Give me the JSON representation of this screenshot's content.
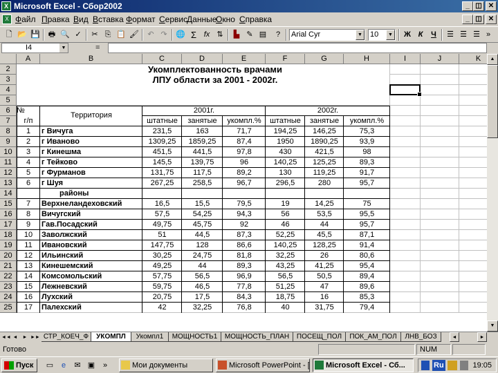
{
  "window": {
    "title": "Microsoft Excel - Сбор2002",
    "controls": [
      "_",
      "◫",
      "✕"
    ],
    "doc_controls": [
      "_",
      "◫",
      "✕"
    ]
  },
  "menu": {
    "items": [
      "Файл",
      "Правка",
      "Вид",
      "Вставка",
      "Формат",
      "Сервис",
      "Данные",
      "Окно",
      "Справка"
    ]
  },
  "toolbar": {
    "font_name": "Arial Cyr",
    "font_size": "10",
    "bold": "Ж",
    "italic": "К",
    "underline": "Ч",
    "sigma": "Σ",
    "fx": "fx"
  },
  "formula_bar": {
    "cell_ref": "I4",
    "equals": "=",
    "value": ""
  },
  "columns": [
    "A",
    "B",
    "C",
    "D",
    "E",
    "F",
    "G",
    "H",
    "I",
    "J",
    "K"
  ],
  "rows": [
    "2",
    "3",
    "4",
    "5",
    "6",
    "7",
    "8",
    "9",
    "10",
    "11",
    "12",
    "13",
    "14",
    "15",
    "16",
    "17",
    "18",
    "19",
    "20",
    "21",
    "22",
    "23",
    "24",
    "25"
  ],
  "sheet": {
    "title_line1": "Укомплектованность врачами",
    "title_line2": "ЛПУ области за  2001 - 2002г.",
    "hdr_no": "№",
    "hdr_gp": "г/п",
    "hdr_territory": "Территория",
    "hdr_2001": "2001г.",
    "hdr_2002": "2002г.",
    "sub_headers": [
      "штатные",
      "занятые",
      "укомпл.%",
      "штатные",
      "занятые",
      "укомпл.%"
    ],
    "data_rows": [
      {
        "n": "1",
        "name": "г Вичуга",
        "v": [
          "231,5",
          "163",
          "71,7",
          "194,25",
          "146,25",
          "75,3"
        ]
      },
      {
        "n": "2",
        "name": "г Иваново",
        "v": [
          "1309,25",
          "1859,25",
          "87,4",
          "1950",
          "1890,25",
          "93,9"
        ]
      },
      {
        "n": "3",
        "name": "г Кинешма",
        "v": [
          "451,5",
          "441,5",
          "97,8",
          "430",
          "421,5",
          "98"
        ]
      },
      {
        "n": "4",
        "name": "г Тейково",
        "v": [
          "145,5",
          "139,75",
          "96",
          "140,25",
          "125,25",
          "89,3"
        ]
      },
      {
        "n": "5",
        "name": "г Фурманов",
        "v": "131,75|117,5|89,2|130|119,25|91,7"
      },
      {
        "n": "6",
        "name": "г Шуя",
        "v": [
          "267,25",
          "258,5",
          "96,7",
          "296,5",
          "280",
          "95,7"
        ]
      },
      {
        "n": "",
        "name": "районы",
        "v": [
          "",
          "",
          "",
          "",
          "",
          ""
        ]
      },
      {
        "n": "7",
        "name": "Верхнеландеховский",
        "v": [
          "16,5",
          "15,5",
          "79,5",
          "19",
          "14,25",
          "75"
        ]
      },
      {
        "n": "8",
        "name": "Вичугский",
        "v": [
          "57,5",
          "54,25",
          "94,3",
          "56",
          "53,5",
          "95,5"
        ]
      },
      {
        "n": "9",
        "name": "Гав.Посадский",
        "v": [
          "49,75",
          "45,75",
          "92",
          "46",
          "44",
          "95,7"
        ]
      },
      {
        "n": "10",
        "name": "Заволжский",
        "v": [
          "51",
          "44,5",
          "87,3",
          "52,25",
          "45,5",
          "87,1"
        ]
      },
      {
        "n": "11",
        "name": "Ивановский",
        "v": [
          "147,75",
          "128",
          "86,6",
          "140,25",
          "128,25",
          "91,4"
        ]
      },
      {
        "n": "12",
        "name": "Ильинский",
        "v": [
          "30,25",
          "24,75",
          "81,8",
          "32,25",
          "26",
          "80,6"
        ]
      },
      {
        "n": "13",
        "name": "Кинешемский",
        "v": [
          "49,25",
          "44",
          "89,3",
          "43,25",
          "41,25",
          "95,4"
        ]
      },
      {
        "n": "14",
        "name": "Комсомольский",
        "v": [
          "57,75",
          "56,5",
          "96,9",
          "56,5",
          "50,5",
          "89,4"
        ]
      },
      {
        "n": "15",
        "name": "Лежневский",
        "v": [
          "59,75",
          "46,5",
          "77,8",
          "51,25",
          "47",
          "89,6"
        ]
      },
      {
        "n": "16",
        "name": "Лухский",
        "v": [
          "20,75",
          "17,5",
          "84,3",
          "18,75",
          "16",
          "85,3"
        ]
      },
      {
        "n": "17",
        "name": "Палехский",
        "v": [
          "42",
          "32,25",
          "76,8",
          "40",
          "31,75",
          "79,4"
        ]
      }
    ]
  },
  "tabs": [
    "СТР_КОЕЧ_Ф",
    "УКОМПЛ",
    "Укомпл1",
    "МОЩНОСТЬ1",
    "МОЩНОСТЬ_ПЛАН",
    "ПОСЕЩ_ПОЛ",
    "ПОК_АМ_ПОЛ",
    "ЛНВ_БОЗ"
  ],
  "status": {
    "ready": "Готово",
    "num": "NUM"
  },
  "taskbar": {
    "start": "Пуск",
    "buttons": [
      "Мои документы",
      "Microsoft PowerPoint - [...",
      "Microsoft Excel - Сб..."
    ],
    "lang": "Ru",
    "clock": "19:05"
  }
}
